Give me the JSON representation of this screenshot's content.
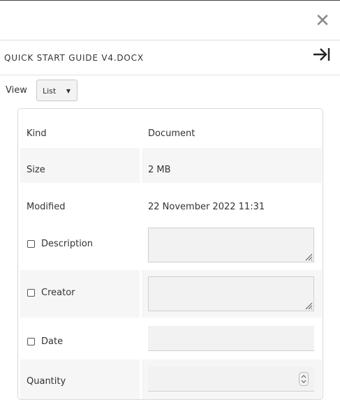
{
  "window": {
    "close_icon": "close-icon"
  },
  "header": {
    "file_name": "QUICK START GUIDE V4.DOCX",
    "collapse_icon": "collapse-right-icon"
  },
  "view": {
    "label": "View",
    "selected": "List"
  },
  "properties": {
    "kind": {
      "label": "Kind",
      "value": "Document"
    },
    "size": {
      "label": "Size",
      "value": "2 MB"
    },
    "modified": {
      "label": "Modified",
      "value": "22 November 2022 11:31"
    },
    "description": {
      "label": "Description",
      "value": ""
    },
    "creator": {
      "label": "Creator",
      "value": ""
    },
    "date": {
      "label": "Date",
      "value": ""
    },
    "quantity": {
      "label": "Quantity",
      "value": ""
    }
  }
}
